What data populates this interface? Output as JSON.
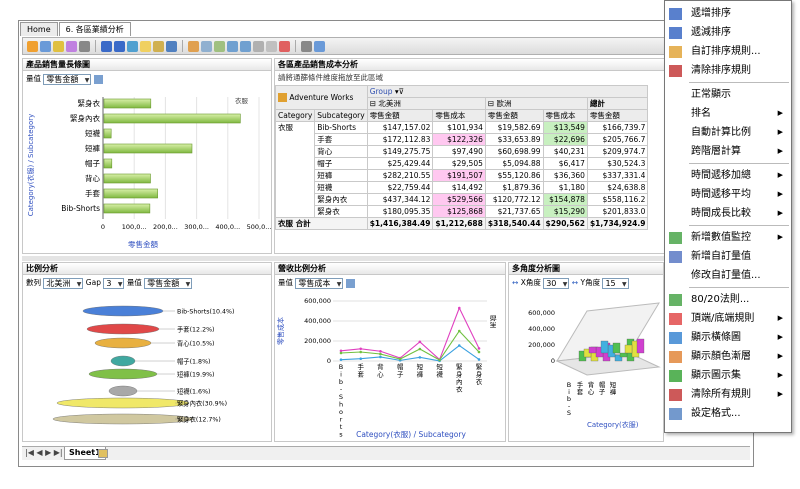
{
  "tabs": [
    "Home",
    "6. 各區業績分析"
  ],
  "sheet_tab": "Sheet1",
  "panel_bar": {
    "title": "產品銷售量長條圖",
    "measure_label": "量值",
    "measure_value": "零售金額",
    "legend": "衣服",
    "y_axis_label": "Category(衣服) / Subcategory",
    "x_axis_label": "零售金額",
    "categories": [
      "緊身衣",
      "緊身內衣",
      "短襪",
      "短褲",
      "帽子",
      "背心",
      "手套",
      "Bib-Shorts"
    ],
    "values": [
      150000,
      437000,
      23000,
      282000,
      25000,
      149000,
      172000,
      147000
    ],
    "x_ticks": [
      "0",
      "100,0...",
      "200,0...",
      "300,0...",
      "400,0...",
      "500,0..."
    ],
    "x_max": 500000
  },
  "pivot": {
    "title": "各區產品銷售成本分析",
    "hint": "請將通篩條件維度拖放至此區域",
    "cube": "Adventure Works",
    "group_label": "Group",
    "regions": [
      "北美洲",
      "歐洲",
      "總計"
    ],
    "col_headers": [
      "Category",
      "Subcategory",
      "零售金額",
      "零售成本",
      "零售金額",
      "零售成本",
      "零售金額"
    ],
    "category": "衣服",
    "rows": [
      [
        "Bib-Shorts",
        "$147,157.02",
        "$101,934",
        "$19,582.69",
        "$13,549",
        "$166,739.7"
      ],
      [
        "手套",
        "$172,112.83",
        "$122,326",
        "$33,653.89",
        "$22,696",
        "$205,766.7"
      ],
      [
        "背心",
        "$149,275.75",
        "$97,490",
        "$60,698.99",
        "$40,231",
        "$209,974.7"
      ],
      [
        "帽子",
        "$25,429.44",
        "$29,505",
        "$5,094.88",
        "$6,417",
        "$30,524.3"
      ],
      [
        "短褲",
        "$282,210.55",
        "$191,507",
        "$55,120.86",
        "$36,360",
        "$337,331.4"
      ],
      [
        "短襪",
        "$22,759.44",
        "$14,492",
        "$1,879.36",
        "$1,180",
        "$24,638.8"
      ],
      [
        "緊身內衣",
        "$437,344.12",
        "$529,566",
        "$120,772.12",
        "$154,878",
        "$558,116.2"
      ],
      [
        "緊身衣",
        "$180,095.35",
        "$125,868",
        "$21,737.65",
        "$15,290",
        "$201,833.0"
      ]
    ],
    "total_label": "衣服 合計",
    "total": [
      "$1,416,384.49",
      "$1,212,688",
      "$318,540.44",
      "$290,562",
      "$1,734,924.9"
    ]
  },
  "panel_ratio": {
    "title": "比例分析",
    "series_label": "數列",
    "series_value": "北美洲",
    "gap_label": "Gap",
    "gap_value": "3",
    "measure_label": "量值",
    "measure_value": "零售金額",
    "labels": [
      "Bib-Shorts(10.4%)",
      "手套(12.2%)",
      "背心(10.5%)",
      "帽子(1.8%)",
      "短褲(19.9%)",
      "短襪(1.6%)",
      "緊身內衣(30.9%)",
      "緊身衣(12.7%)"
    ]
  },
  "panel_line": {
    "title": "營收比例分析",
    "measure_label": "量值",
    "measure_value": "零售成本",
    "legend": "歐洲",
    "y_axis_label": "零售成本",
    "x_axis_label": "Category(衣服) / Subcategory",
    "y_ticks": [
      "600,000",
      "400,000",
      "200,000",
      "0"
    ],
    "categories": [
      "Bib-Shorts",
      "手套",
      "背心",
      "帽子",
      "短褲",
      "短襪",
      "緊身內衣",
      "緊身衣"
    ],
    "series": [
      {
        "values": [
          101934,
          122326,
          97490,
          29505,
          191507,
          14492,
          529566,
          125868
        ],
        "color": "#e040c0"
      },
      {
        "values": [
          13549,
          22696,
          40231,
          6417,
          36360,
          1180,
          154878,
          15290
        ],
        "color": "#3aa0e0"
      },
      {
        "values": [
          80000,
          90000,
          70000,
          20000,
          120000,
          10000,
          300000,
          90000
        ],
        "color": "#70c040"
      }
    ]
  },
  "panel_3d": {
    "title": "多角度分析圖",
    "x_angle_label": "X角度",
    "x_angle_value": "30",
    "y_angle_label": "Y角度",
    "y_angle_value": "15",
    "y_ticks": [
      "600,000",
      "400,000",
      "200,000",
      "0"
    ],
    "categories": [
      "Bib-Shorts",
      "手套",
      "背心",
      "帽子",
      "短褲"
    ],
    "x_axis_label": "Category(衣服)"
  },
  "context_menu": {
    "items": [
      {
        "label": "遞增排序",
        "icon": "sort-ascending-icon",
        "submenu": false
      },
      {
        "label": "遞減排序",
        "icon": "sort-descending-icon",
        "submenu": false
      },
      {
        "label": "自訂排序規則...",
        "icon": "custom-sort-icon",
        "submenu": false
      },
      {
        "label": "清除排序規則",
        "icon": "clear-sort-icon",
        "submenu": false
      },
      {
        "label": "正常顯示",
        "icon": "",
        "submenu": false
      },
      {
        "label": "排名",
        "icon": "",
        "submenu": true
      },
      {
        "label": "自動計算比例",
        "icon": "",
        "submenu": true
      },
      {
        "label": "跨階層計算",
        "icon": "",
        "submenu": true
      },
      {
        "label": "時間遞移加總",
        "icon": "",
        "submenu": true
      },
      {
        "label": "時間遞移平均",
        "icon": "",
        "submenu": true
      },
      {
        "label": "時間成長比較",
        "icon": "",
        "submenu": true
      },
      {
        "label": "新增數值監控",
        "icon": "kpi-monitor-icon",
        "submenu": true
      },
      {
        "label": "新增自訂量值",
        "icon": "calculator-icon",
        "submenu": false
      },
      {
        "label": "修改自訂量值...",
        "icon": "",
        "submenu": false
      },
      {
        "label": "80/20法則...",
        "icon": "pareto-chart-icon",
        "submenu": false
      },
      {
        "label": "頂端/底端規則",
        "icon": "top-bottom-rule-icon",
        "submenu": true
      },
      {
        "label": "顯示橫條圖",
        "icon": "data-bar-icon",
        "submenu": true
      },
      {
        "label": "顯示顏色漸層",
        "icon": "color-scale-icon",
        "submenu": true
      },
      {
        "label": "顯示圖示集",
        "icon": "icon-set-icon",
        "submenu": true
      },
      {
        "label": "清除所有規則",
        "icon": "clear-rules-icon",
        "submenu": true
      },
      {
        "label": "設定格式...",
        "icon": "format-icon",
        "submenu": false
      }
    ]
  }
}
